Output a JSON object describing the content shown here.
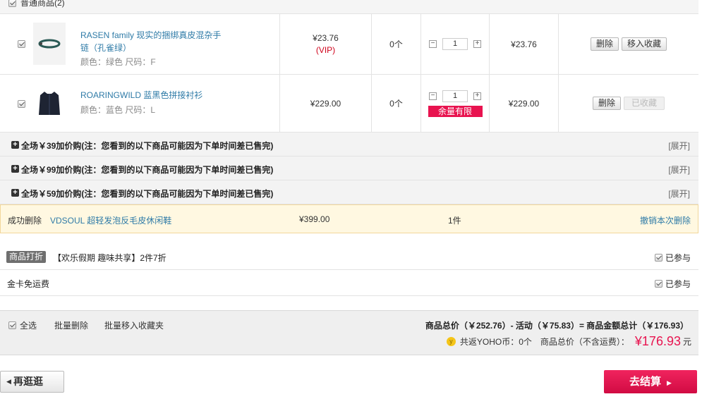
{
  "section": {
    "title": "普通商品(2)"
  },
  "products": [
    {
      "name": "RASEN family 现实的捆绑真皮混杂手链（孔雀绿）",
      "attrs": "颜色：绿色  尺码：F",
      "price": "¥23.76",
      "price_note": "(VIP)",
      "stock": "0个",
      "qty": "1",
      "subtotal": "¥23.76",
      "delete_label": "删除",
      "fav_label": "移入收藏",
      "thumb_icon": "bracelet-icon"
    },
    {
      "name": "ROARINGWILD 蓝黑色拼接衬衫",
      "attrs": "颜色：蓝色  尺码：L",
      "price": "¥229.00",
      "stock": "0个",
      "qty": "1",
      "stock_warning": "余量有限",
      "subtotal": "¥229.00",
      "delete_label": "删除",
      "fav_label": "已收藏",
      "thumb_icon": "shirt-icon"
    }
  ],
  "addons": [
    {
      "text": "全场￥39加价购(注：您看到的以下商品可能因为下单时间差已售完)",
      "expand": "[展开]"
    },
    {
      "text": "全场￥99加价购(注：您看到的以下商品可能因为下单时间差已售完)",
      "expand": "[展开]"
    },
    {
      "text": "全场￥59加价购(注：您看到的以下商品可能因为下单时间差已售完)",
      "expand": "[展开]"
    }
  ],
  "deleted": {
    "label": "成功删除",
    "name": "VDSOUL 超轻发泡反毛皮休闲鞋",
    "price": "¥399.00",
    "qty": "1件",
    "undo": "撤销本次删除"
  },
  "promos": [
    {
      "tag": "商品打折",
      "text": "【欢乐假期 趣味共享】2件7折",
      "join": "已参与"
    },
    {
      "tag": "",
      "text": "金卡免运费",
      "join": "已参与"
    }
  ],
  "footer": {
    "select_all": "全选",
    "batch_delete": "批量删除",
    "batch_fav": "批量移入收藏夹",
    "summary": "商品总价（￥252.76）- 活动（￥75.83）= 商品金额总计（￥176.93）",
    "yoho": "共返YOHO币：0个",
    "total_label": "商品总价（不含运费）：",
    "total": "¥176.93",
    "unit": "元"
  },
  "actions": {
    "back": "再逛逛",
    "checkout": "去结算"
  },
  "colors": {
    "accent": "#e8134f",
    "link": "#2f7ba7"
  }
}
